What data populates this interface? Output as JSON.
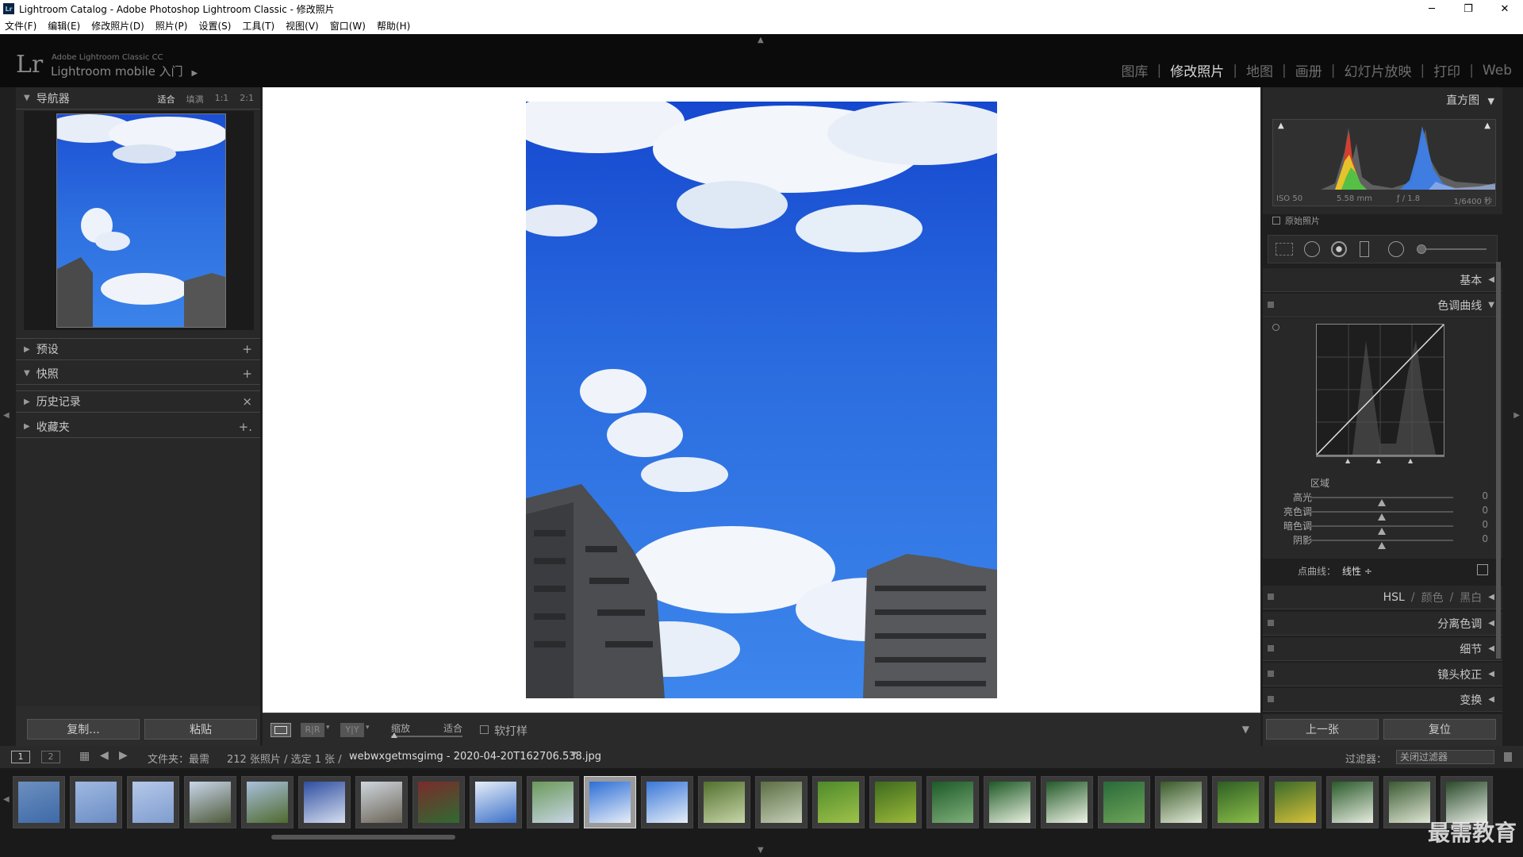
{
  "window": {
    "title": "Lightroom Catalog - Adobe Photoshop Lightroom Classic - 修改照片",
    "controls": [
      "─",
      "❐",
      "✕"
    ]
  },
  "menu": [
    "文件(F)",
    "编辑(E)",
    "修改照片(D)",
    "照片(P)",
    "设置(S)",
    "工具(T)",
    "视图(V)",
    "窗口(W)",
    "帮助(H)"
  ],
  "identity": {
    "logo": "Lr",
    "line1": "Adobe Lightroom Classic CC",
    "line2": "Lightroom mobile 入门",
    "modules": [
      "图库",
      "修改照片",
      "地图",
      "画册",
      "幻灯片放映",
      "打印",
      "Web"
    ],
    "active_module": "修改照片"
  },
  "left": {
    "navigator": {
      "title": "导航器",
      "zoom": [
        "适合",
        "填满",
        "1:1",
        "2:1"
      ]
    },
    "panels": [
      {
        "title": "预设",
        "action": "+"
      },
      {
        "title": "快照",
        "action": "+"
      },
      {
        "title": "历史记录",
        "action": "×"
      },
      {
        "title": "收藏夹",
        "action": "+."
      }
    ],
    "copy_label": "复制...",
    "paste_label": "粘贴"
  },
  "toolbar": {
    "zoom_label": "缩放",
    "fit_label": "适合",
    "softproof_label": "软打样"
  },
  "right": {
    "histogram_title": "直方图",
    "exif": {
      "iso": "ISO 50",
      "focal": "5.58 mm",
      "aperture": "ƒ / 1.8",
      "shutter": "1/6400 秒"
    },
    "original_label": "原始照片",
    "basic_label": "基本",
    "tonecurve_label": "色调曲线",
    "region_label": "区域",
    "sliders": [
      {
        "label": "高光",
        "value": "0"
      },
      {
        "label": "亮色调",
        "value": "0"
      },
      {
        "label": "暗色调",
        "value": "0"
      },
      {
        "label": "阴影",
        "value": "0"
      }
    ],
    "pointcurve_label": "点曲线：",
    "pointcurve_value": "线性 ÷",
    "hsl": [
      "HSL",
      "/",
      "颜色",
      "/",
      "黑白"
    ],
    "sections": [
      "分离色调",
      "细节",
      "镜头校正",
      "变换"
    ],
    "prev_label": "上一张",
    "reset_label": "复位"
  },
  "filmstrip": {
    "pages": [
      "1",
      "2"
    ],
    "source": "文件夹：最需",
    "count": "212 张照片 / 选定 1 张 /",
    "filename": "webwxgetmsgimg - 2020-04-20T162706.538.jpg",
    "filter_label": "过滤器：",
    "filter_value": "关闭过滤器",
    "thumbs": [
      {
        "c1": "#6d8fbf",
        "c2": "#3d6aa8",
        "sel": false
      },
      {
        "c1": "#9fb8e0",
        "c2": "#6b8dc5",
        "sel": false
      },
      {
        "c1": "#b5c8e8",
        "c2": "#7f9dd0",
        "sel": false
      },
      {
        "c1": "#c9d6ea",
        "c2": "#4e5a3a",
        "sel": false
      },
      {
        "c1": "#a9c0dc",
        "c2": "#4f6a2e",
        "sel": false
      },
      {
        "c1": "#2e4fa0",
        "c2": "#d6def0",
        "sel": false
      },
      {
        "c1": "#cfd6dd",
        "c2": "#6b6456",
        "sel": false
      },
      {
        "c1": "#7a2b2b",
        "c2": "#2f6b32",
        "sel": false
      },
      {
        "c1": "#e6eef8",
        "c2": "#3b70c8",
        "sel": false
      },
      {
        "c1": "#6b9a5a",
        "c2": "#c8d6e6",
        "sel": false
      },
      {
        "c1": "#2d6fd6",
        "c2": "#e8eef8",
        "sel": true
      },
      {
        "c1": "#3a78d8",
        "c2": "#e6eef8",
        "sel": false
      },
      {
        "c1": "#53702f",
        "c2": "#c7d6a8",
        "sel": false
      },
      {
        "c1": "#5c6f44",
        "c2": "#c6cfb8",
        "sel": false
      },
      {
        "c1": "#4f8a2a",
        "c2": "#9ec24a",
        "sel": false
      },
      {
        "c1": "#3e6a1e",
        "c2": "#9cba3a",
        "sel": false
      },
      {
        "c1": "#1e5a2a",
        "c2": "#7fb07a",
        "sel": false
      },
      {
        "c1": "#1f5a26",
        "c2": "#e8f0e0",
        "sel": false
      },
      {
        "c1": "#245a2a",
        "c2": "#eef4e6",
        "sel": false
      },
      {
        "c1": "#2a6a3a",
        "c2": "#6fa65a",
        "sel": false
      },
      {
        "c1": "#3a5a2a",
        "c2": "#e2ead8",
        "sel": false
      },
      {
        "c1": "#2e5e24",
        "c2": "#8cbf4a",
        "sel": false
      },
      {
        "c1": "#3a6a2a",
        "c2": "#d8c23a",
        "sel": false
      },
      {
        "c1": "#2a5a2a",
        "c2": "#e6ecdf",
        "sel": false
      },
      {
        "c1": "#3a5a32",
        "c2": "#dfe6d4",
        "sel": false
      },
      {
        "c1": "#2a4a2a",
        "c2": "#e8eee6",
        "sel": false
      }
    ]
  },
  "watermark": "最需教育"
}
